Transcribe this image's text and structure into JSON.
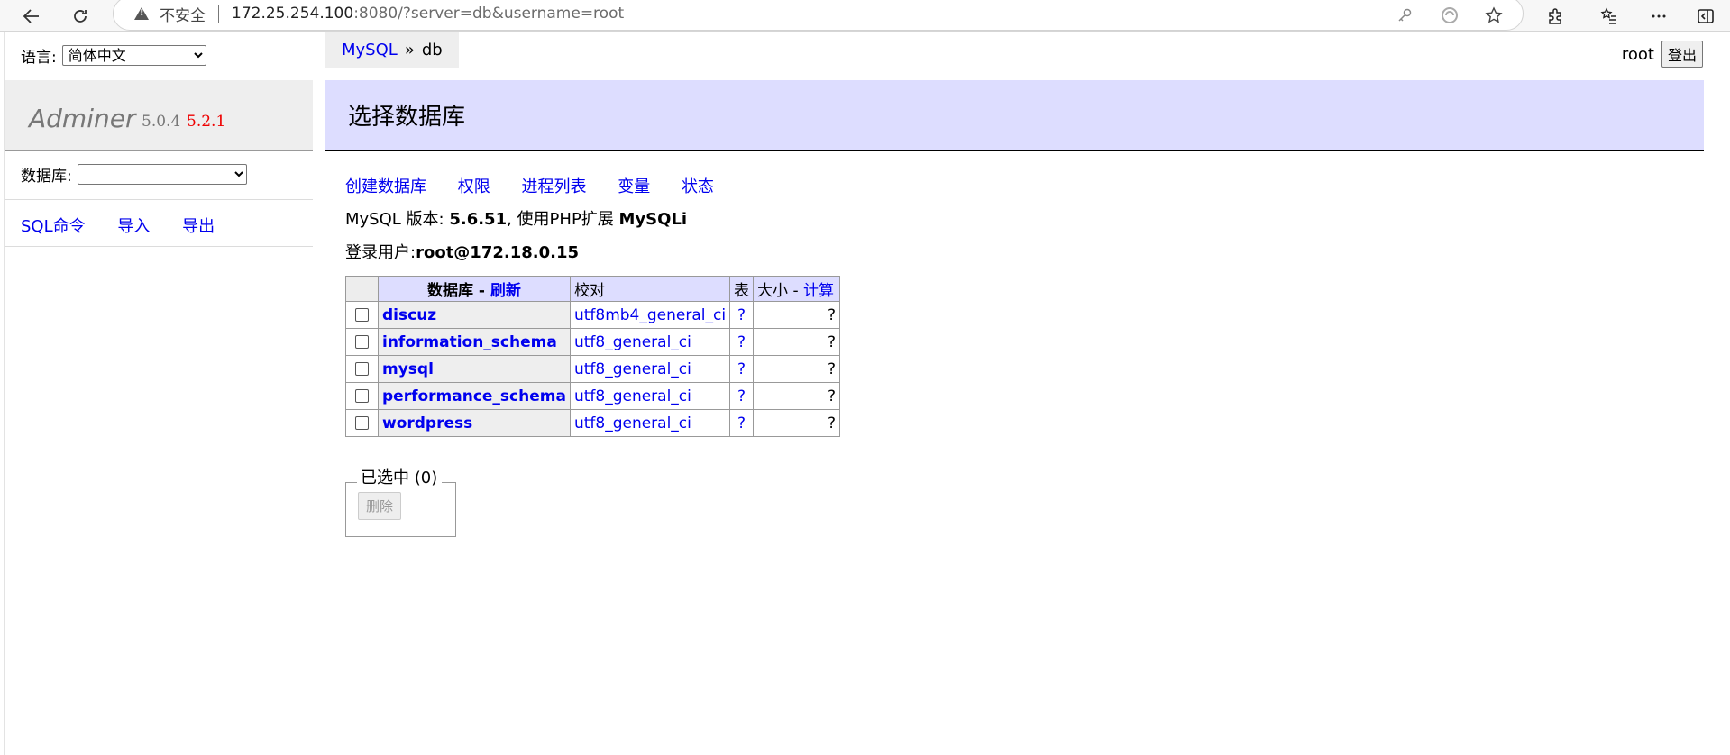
{
  "browser": {
    "insecure_label": "不安全",
    "url_host": "172.25.254.100",
    "url_rest": ":8080/?server=db&username=root"
  },
  "sidebar": {
    "language_label": "语言:",
    "language_selected": "简体中文",
    "brand": "Adminer",
    "version": "5.0.4",
    "new_version": "5.2.1",
    "database_label": "数据库:",
    "links": [
      "SQL命令",
      "导入",
      "导出"
    ]
  },
  "breadcrumb": {
    "driver": "MySQL",
    "sep": "»",
    "server": "db"
  },
  "header": {
    "user": "root",
    "logout": "登出",
    "title": "选择数据库"
  },
  "content": {
    "links": [
      "创建数据库",
      "权限",
      "进程列表",
      "变量",
      "状态"
    ],
    "version_prefix": "MySQL 版本:",
    "version_value": "5.6.51",
    "version_mid": ", 使用PHP扩展",
    "extension": "MySQLi",
    "login_prefix": "登录用户:",
    "login_value": "root@172.18.0.15"
  },
  "table": {
    "headers": {
      "database": "数据库",
      "refresh_sep": " - ",
      "refresh": "刷新",
      "collation": "校对",
      "tables": "表",
      "size": "大小",
      "compute_sep": " - ",
      "compute": "计算"
    },
    "rows": [
      {
        "name": "discuz",
        "collation": "utf8mb4_general_ci",
        "tables": "?",
        "size": "?"
      },
      {
        "name": "information_schema",
        "collation": "utf8_general_ci",
        "tables": "?",
        "size": "?"
      },
      {
        "name": "mysql",
        "collation": "utf8_general_ci",
        "tables": "?",
        "size": "?"
      },
      {
        "name": "performance_schema",
        "collation": "utf8_general_ci",
        "tables": "?",
        "size": "?"
      },
      {
        "name": "wordpress",
        "collation": "utf8_general_ci",
        "tables": "?",
        "size": "?"
      }
    ]
  },
  "selection": {
    "legend": "已选中 (0)",
    "delete": "删除"
  },
  "colors": {
    "link": "#0000ee",
    "header_bg": "#ddddff",
    "menu_bg": "#eeeeee",
    "new_version": "#ee0000"
  }
}
